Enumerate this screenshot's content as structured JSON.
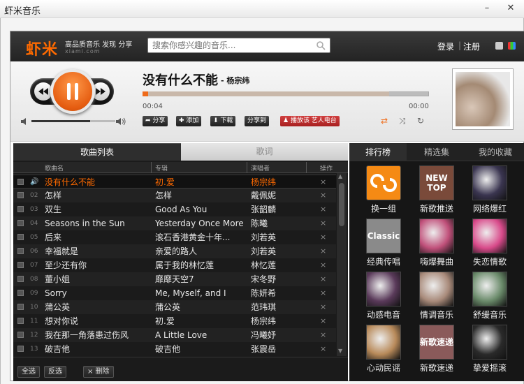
{
  "window": {
    "title": "虾米音乐",
    "minimize": "–",
    "close": "✕"
  },
  "header": {
    "logo": "虾米",
    "slogan": "高品质音乐 发现 分享",
    "domain": "xiami.com",
    "search_placeholder": "搜索你感兴趣的音乐...",
    "login": "登录",
    "separator": "|",
    "register": "注册"
  },
  "player": {
    "title": "没有什么不能",
    "artist": "- 杨宗纬",
    "time_current": "00:04",
    "time_total": "00:00",
    "progress_fraction": 0.02,
    "buffer_fraction": 0.86,
    "volume_fraction": 0.7,
    "actions": {
      "share": "分享",
      "add": "添加",
      "download": "下载",
      "share_to": "分享到",
      "radio": "播放该 艺人电台"
    }
  },
  "list": {
    "tab_songs": "歌曲列表",
    "tab_lyrics": "歌词",
    "col_name": "歌曲名",
    "col_album": "专辑",
    "col_artist": "演唱者",
    "col_ops": "操作",
    "delete_glyph": "×",
    "rows": [
      {
        "num": "",
        "name": "没有什么不能",
        "album": "初.爱",
        "artist": "杨宗纬",
        "active": true
      },
      {
        "num": "02",
        "name": "怎样",
        "album": "怎样",
        "artist": "戴佩妮"
      },
      {
        "num": "03",
        "name": "双生",
        "album": "Good As You",
        "artist": "张韶麟"
      },
      {
        "num": "04",
        "name": "Seasons in the Sun",
        "album": "Yesterday Once More",
        "artist": "陈曦"
      },
      {
        "num": "05",
        "name": "后来",
        "album": "滚石香港黄金十年...",
        "artist": "刘若英"
      },
      {
        "num": "06",
        "name": "幸福就是",
        "album": "亲爱的路人",
        "artist": "刘若英"
      },
      {
        "num": "07",
        "name": "至少还有你",
        "album": "属于我的林忆莲",
        "artist": "林忆莲"
      },
      {
        "num": "08",
        "name": "董小姐",
        "album": "靡靡天空7",
        "artist": "宋冬野"
      },
      {
        "num": "09",
        "name": "Sorry",
        "album": "Me, Myself, and I",
        "artist": "陈妍希"
      },
      {
        "num": "10",
        "name": "蒲公英",
        "album": "蒲公英",
        "artist": "范玮琪"
      },
      {
        "num": "11",
        "name": "想对你说",
        "album": "初.爱",
        "artist": "杨宗纬"
      },
      {
        "num": "12",
        "name": "我在那一角落患过伤风",
        "album": "A Little Love",
        "artist": "冯曦妤"
      },
      {
        "num": "13",
        "name": "破吉他",
        "album": "破吉他",
        "artist": "张震岳"
      }
    ],
    "select_all": "全选",
    "invert": "反选",
    "delete": "× 删除"
  },
  "right": {
    "tabs": [
      "排行榜",
      "精选集",
      "我的收藏"
    ],
    "tiles": [
      {
        "label": "换一组",
        "color": "#f58a14"
      },
      {
        "label": "新歌推送",
        "color": "#7a4a3a",
        "art": "NEW TOP"
      },
      {
        "label": "网络爆红",
        "color": "#3a3550"
      },
      {
        "label": "经典传唱",
        "color": "#8a8a8a",
        "art": "Classic"
      },
      {
        "label": "嗨爆舞曲",
        "color": "#c0507a"
      },
      {
        "label": "失恋情歌",
        "color": "#d84a8a"
      },
      {
        "label": "动感电音",
        "color": "#5a3a5a"
      },
      {
        "label": "情调音乐",
        "color": "#a88a7a"
      },
      {
        "label": "舒缓音乐",
        "color": "#6a8a6a"
      },
      {
        "label": "心动民谣",
        "color": "#b88a5a"
      },
      {
        "label": "新歌速递",
        "color": "#8a5a5a",
        "art": "新歌速递"
      },
      {
        "label": "挚爱摇滚",
        "color": "#2a2a2a"
      }
    ]
  }
}
